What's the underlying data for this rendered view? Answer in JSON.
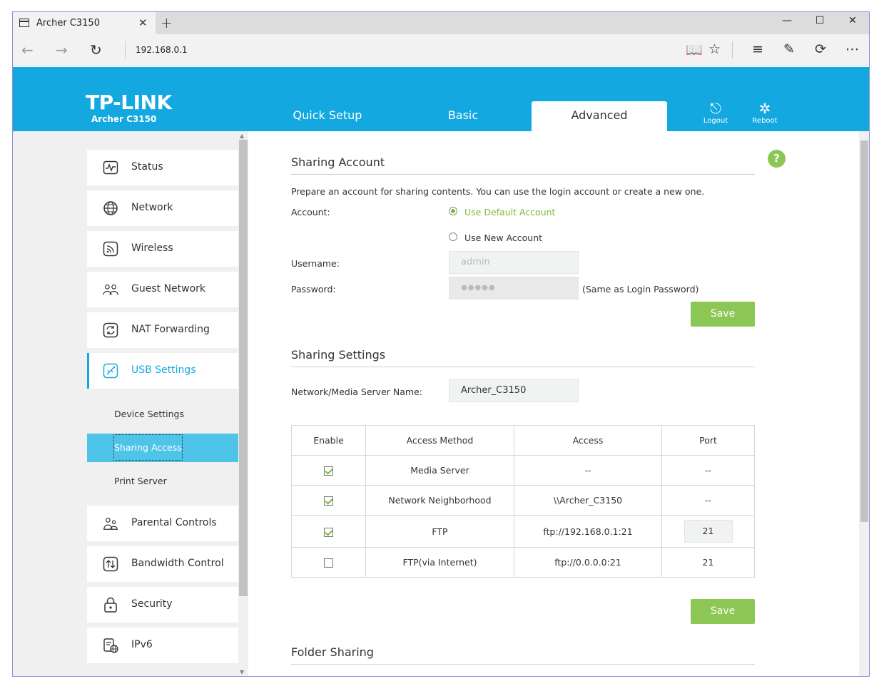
{
  "browser": {
    "tab_title": "Archer C3150",
    "url": "192.168.0.1",
    "new_tab": "+",
    "close": "✕",
    "minimize": "—",
    "maximize": "☐",
    "win_close": "✕"
  },
  "header": {
    "logo": "TP-LINK",
    "model": "Archer C3150",
    "tabs": [
      "Quick Setup",
      "Basic",
      "Advanced"
    ],
    "active_tab": "Advanced",
    "logout": "Logout",
    "reboot": "Reboot",
    "color": "#13a9e0"
  },
  "sidebar": {
    "items": [
      {
        "label": "Status",
        "icon": "status-icon"
      },
      {
        "label": "Network",
        "icon": "globe-icon"
      },
      {
        "label": "Wireless",
        "icon": "wireless-icon"
      },
      {
        "label": "Guest Network",
        "icon": "guest-icon"
      },
      {
        "label": "NAT Forwarding",
        "icon": "nat-icon"
      },
      {
        "label": "USB Settings",
        "icon": "usb-icon",
        "active": true
      },
      {
        "label": "Parental Controls",
        "icon": "parental-icon"
      },
      {
        "label": "Bandwidth Control",
        "icon": "bandwidth-icon"
      },
      {
        "label": "Security",
        "icon": "lock-icon"
      },
      {
        "label": "IPv6",
        "icon": "ipv6-icon"
      }
    ],
    "sub_items": [
      {
        "label": "Device Settings"
      },
      {
        "label": "Sharing Access",
        "active": true
      },
      {
        "label": "Print Server"
      }
    ]
  },
  "sharing_account": {
    "title": "Sharing Account",
    "description": "Prepare an account for sharing contents. You can use the login account or create a new one.",
    "account_label": "Account:",
    "option_default": "Use Default Account",
    "option_new": "Use New Account",
    "selected": "Use Default Account",
    "username_label": "Username:",
    "username_placeholder": "admin",
    "password_label": "Password:",
    "password_value": "●●●●●",
    "password_note": "(Same as Login Password)",
    "save": "Save"
  },
  "sharing_settings": {
    "title": "Sharing Settings",
    "server_name_label": "Network/Media Server Name:",
    "server_name_value": "Archer_C3150",
    "table": {
      "headers": [
        "Enable",
        "Access Method",
        "Access",
        "Port"
      ],
      "rows": [
        {
          "enabled": true,
          "method": "Media Server",
          "access": "--",
          "port": "--",
          "port_editable": false
        },
        {
          "enabled": true,
          "method": "Network Neighborhood",
          "access": "\\\\Archer_C3150",
          "port": "--",
          "port_editable": false
        },
        {
          "enabled": true,
          "method": "FTP",
          "access": "ftp://192.168.0.1:21",
          "port": "21",
          "port_editable": true
        },
        {
          "enabled": false,
          "method": "FTP(via Internet)",
          "access": "ftp://0.0.0.0:21",
          "port": "21",
          "port_editable": false
        }
      ]
    },
    "save": "Save"
  },
  "folder_sharing": {
    "title": "Folder Sharing"
  },
  "help": "?"
}
